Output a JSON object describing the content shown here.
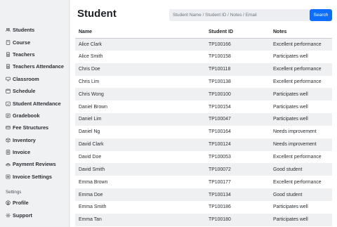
{
  "sidebar": {
    "items": [
      {
        "label": "Students",
        "icon": "people-icon"
      },
      {
        "label": "Course",
        "icon": "book-icon"
      },
      {
        "label": "Teachers",
        "icon": "person-badge-icon"
      },
      {
        "label": "Teachers Attendance",
        "icon": "person-badge-icon"
      },
      {
        "label": "Classroom",
        "icon": "display-icon"
      },
      {
        "label": "Schedule",
        "icon": "calendar-icon"
      },
      {
        "label": "Student Attendance",
        "icon": "calendar-check-icon"
      },
      {
        "label": "Gradebook",
        "icon": "journal-icon"
      },
      {
        "label": "Fee Structures",
        "icon": "card-icon"
      },
      {
        "label": "Inventory",
        "icon": "box-icon"
      },
      {
        "label": "Invoice",
        "icon": "receipt-icon"
      },
      {
        "label": "Payment Reviews",
        "icon": "cash-icon"
      },
      {
        "label": "Invoice Settings",
        "icon": "list-icon"
      }
    ],
    "settings_heading": "Settings",
    "settings_items": [
      {
        "label": "Profile",
        "icon": "person-circle-icon"
      },
      {
        "label": "Support",
        "icon": "gear-icon"
      }
    ]
  },
  "main": {
    "title": "Student",
    "search": {
      "placeholder": "Student Name / Student ID / Notes / Email",
      "button_label": "Search"
    },
    "table": {
      "columns": [
        "Name",
        "Student ID",
        "Notes"
      ],
      "rows": [
        [
          "Alice Clark",
          "TP100166",
          "Excellent performance"
        ],
        [
          "Alice Smith",
          "TP100158",
          "Participates well"
        ],
        [
          "Chris Doe",
          "TP100118",
          "Excellent performance"
        ],
        [
          "Chris Lim",
          "TP100138",
          "Excellent performance"
        ],
        [
          "Chris Wong",
          "TP100100",
          "Participates well"
        ],
        [
          "Daniel Brown",
          "TP100154",
          "Participates well"
        ],
        [
          "Daniel Lim",
          "TP100047",
          "Participates well"
        ],
        [
          "Daniel Ng",
          "TP100164",
          "Needs improvement"
        ],
        [
          "David Clark",
          "TP100124",
          "Needs improvement"
        ],
        [
          "David Doe",
          "TP100053",
          "Excellent performance"
        ],
        [
          "David Smith",
          "TP100072",
          "Good student"
        ],
        [
          "Emma Brown",
          "TP100177",
          "Excellent performance"
        ],
        [
          "Emma Doe",
          "TP100134",
          "Good student"
        ],
        [
          "Emma Smith",
          "TP100186",
          "Participates well"
        ],
        [
          "Emma Tan",
          "TP100180",
          "Participates well"
        ]
      ]
    }
  },
  "colors": {
    "accent": "#0d6efd",
    "sidebar_bg": "#f0f1f3",
    "stripe": "#eef0f2"
  }
}
